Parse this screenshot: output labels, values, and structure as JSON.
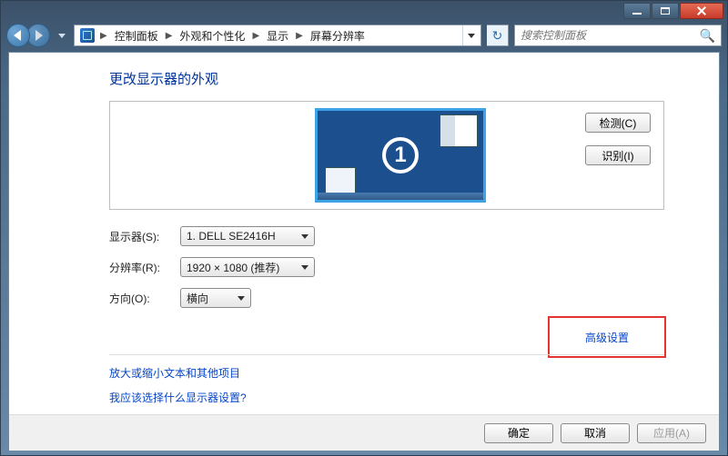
{
  "window": {
    "minimize_tip": "Minimize",
    "maximize_tip": "Maximize",
    "close_tip": "Close"
  },
  "breadcrumb": {
    "items": [
      "控制面板",
      "外观和个性化",
      "显示",
      "屏幕分辨率"
    ]
  },
  "search": {
    "placeholder": "搜索控制面板"
  },
  "page": {
    "title": "更改显示器的外观",
    "monitor_number": "1"
  },
  "side_buttons": {
    "detect": "检测(C)",
    "identify": "识别(I)"
  },
  "form": {
    "display_label": "显示器(S):",
    "display_value": "1. DELL SE2416H",
    "resolution_label": "分辨率(R):",
    "resolution_value": "1920 × 1080 (推荐)",
    "orientation_label": "方向(O):",
    "orientation_value": "横向"
  },
  "links": {
    "advanced": "高级设置",
    "text_size": "放大或缩小文本和其他项目",
    "which_display": "我应该选择什么显示器设置?"
  },
  "footer": {
    "ok": "确定",
    "cancel": "取消",
    "apply": "应用(A)"
  }
}
